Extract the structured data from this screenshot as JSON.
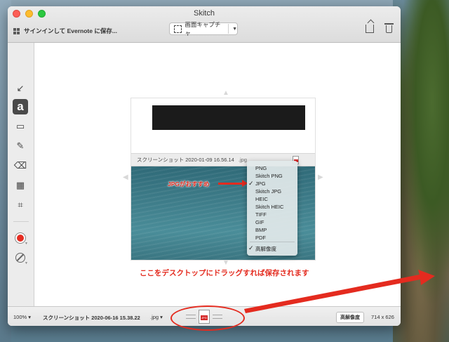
{
  "window": {
    "title": "Skitch",
    "signin_label": "サインインして Evernote に保存...",
    "capture_label": "画面キャプチャ"
  },
  "tools": [
    {
      "name": "arrow-tool",
      "icon": "arrow-icon",
      "glyph": "↙"
    },
    {
      "name": "text-tool",
      "icon": "text-a-icon",
      "glyph": "a"
    },
    {
      "name": "rectangle-tool",
      "icon": "rectangle-icon",
      "glyph": "▭"
    },
    {
      "name": "marker-tool",
      "icon": "pen-icon",
      "glyph": "✎"
    },
    {
      "name": "eraser-tool",
      "icon": "eraser-icon",
      "glyph": "⌫"
    },
    {
      "name": "pixelate-tool",
      "icon": "pixelate-icon",
      "glyph": "▦"
    },
    {
      "name": "crop-tool",
      "icon": "crop-icon",
      "glyph": "⌗"
    }
  ],
  "embedded": {
    "filename": "スクリーンショット 2020-01-09 16.56.14",
    "ext": ".jpg",
    "annotation": "JPGがおすすめ"
  },
  "format_menu": {
    "items": [
      "PNG",
      "Skitch PNG",
      "JPG",
      "Skitch JPG",
      "HEIC",
      "Skitch HEIC",
      "TIFF",
      "GIF",
      "BMP",
      "PDF"
    ],
    "checked_item": "JPG",
    "hires_item": "高解像度"
  },
  "annotation_main": "ここをデスクトップにドラッグすれば保存されます",
  "status": {
    "zoom": "100%",
    "filename": "スクリーンショット 2020-06-16 15.38.22",
    "ext": ".jpg",
    "hires_label": "高解像度",
    "dimensions": "714 x 626",
    "drag_file_label": "JPG"
  },
  "colors": {
    "accent_red": "#e42b1f",
    "selected_color": "#e52d22"
  }
}
